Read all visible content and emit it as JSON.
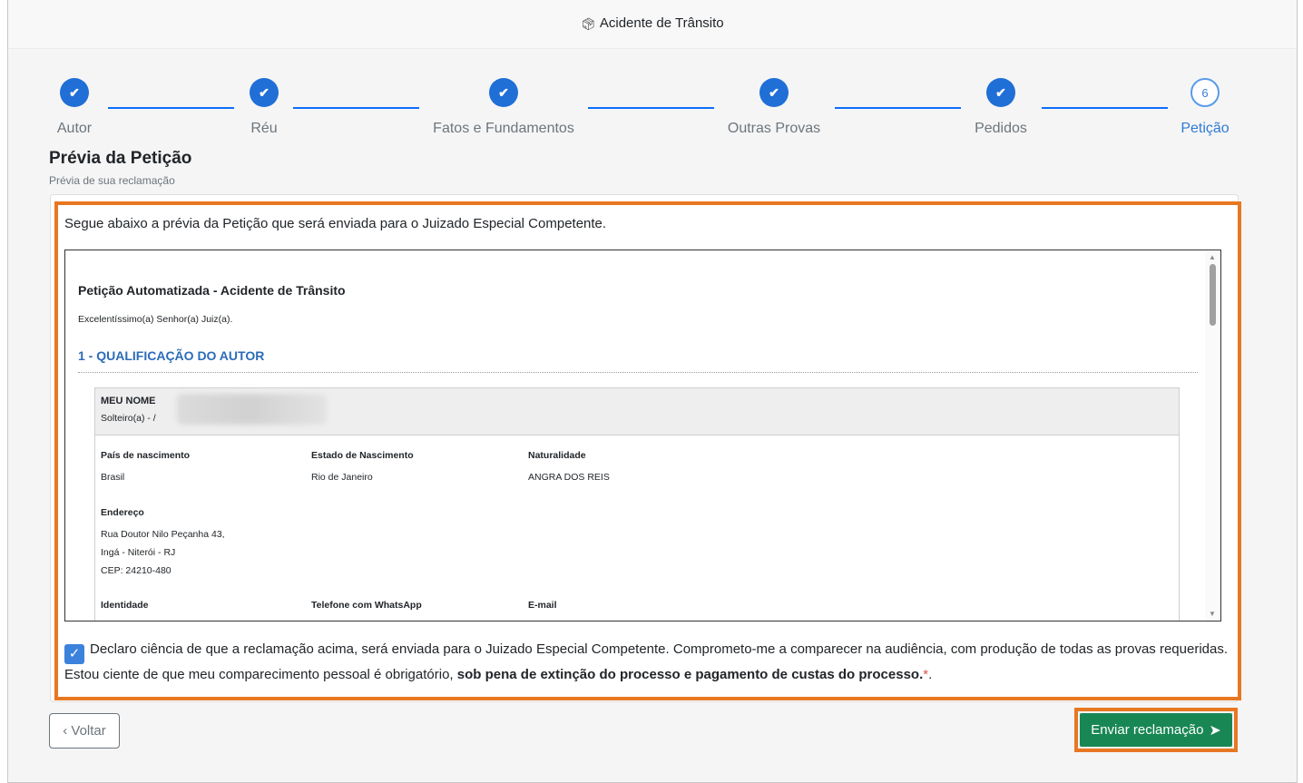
{
  "window": {
    "title": "Acidente de Trânsito",
    "title_icon": "box-icon"
  },
  "stepper": {
    "steps": [
      {
        "label": "Autor",
        "state": "done"
      },
      {
        "label": "Réu",
        "state": "done"
      },
      {
        "label": "Fatos e Fundamentos",
        "state": "done"
      },
      {
        "label": "Outras Provas",
        "state": "done"
      },
      {
        "label": "Pedidos",
        "state": "done"
      },
      {
        "label": "Petição",
        "state": "current",
        "number": "6"
      }
    ]
  },
  "section": {
    "title": "Prévia da Petição",
    "subtitle": "Prévia de sua reclamação"
  },
  "intro": "Segue abaixo a prévia da Petição que será enviada para o Juizado Especial Competente.",
  "document": {
    "title": "Petição Automatizada - Acidente de Trânsito",
    "greeting": "Excelentíssimo(a) Senhor(a) Juiz(a).",
    "section1": "1 - QUALIFICAÇÃO DO AUTOR",
    "autor": {
      "name": "MEU NOME",
      "civil": "Solteiro(a) - /",
      "pais_label": "País de nascimento",
      "pais_value": "Brasil",
      "estado_label": "Estado de Nascimento",
      "estado_value": "Rio de Janeiro",
      "natural_label": "Naturalidade",
      "natural_value": "ANGRA DOS REIS",
      "endereco_label": "Endereço",
      "endereco_line1": "Rua Doutor Nilo Peçanha 43,",
      "endereco_line2": "Ingá - Niterói - RJ",
      "endereco_line3": "CEP: 24210-480",
      "identidade_label": "Identidade",
      "telefone_label": "Telefone com WhatsApp",
      "email_label": "E-mail"
    }
  },
  "declaration": {
    "checked": true,
    "text": "Declaro ciência de que a reclamação acima, será enviada para o Juizado Especial Competente. Comprometo-me a comparecer na audiência, com produção de todas as provas requeridas. Estou ciente de que meu comparecimento pessoal é obrigatório, ",
    "bold": "sob pena de extinção do processo e pagamento de custas do processo.",
    "required_mark": "*",
    "end": "."
  },
  "buttons": {
    "back": "‹ Voltar",
    "send": "Enviar reclamação"
  },
  "colors": {
    "primary": "#1f6fd6",
    "success": "#198754",
    "highlight": "#e87722"
  }
}
